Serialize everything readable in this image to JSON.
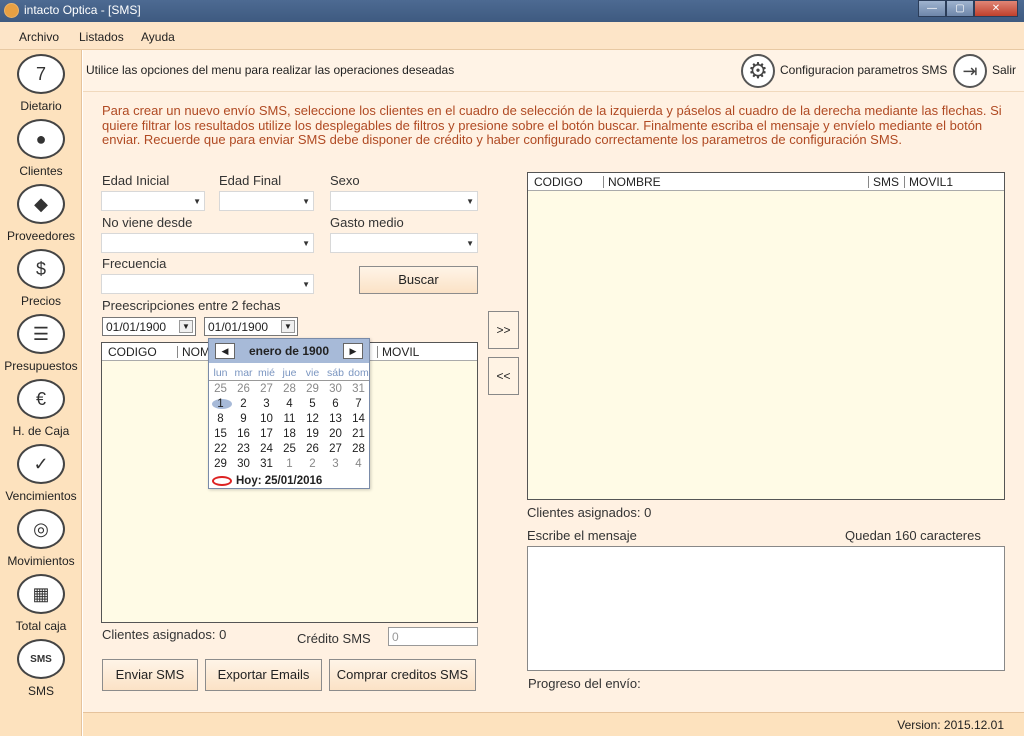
{
  "window": {
    "title": "intacto Optica - [SMS]"
  },
  "menu": [
    "Archivo",
    "Listados",
    "Ayuda"
  ],
  "sidebar": [
    {
      "label": "Dietario",
      "icon": "calendar-icon"
    },
    {
      "label": "Clientes",
      "icon": "user-icon"
    },
    {
      "label": "Proveedores",
      "icon": "supplier-icon"
    },
    {
      "label": "Precios",
      "icon": "price-tag-icon"
    },
    {
      "label": "Presupuestos",
      "icon": "budget-icon"
    },
    {
      "label": "H. de Caja",
      "icon": "cash-sheet-icon"
    },
    {
      "label": "Vencimientos",
      "icon": "checklist-icon"
    },
    {
      "label": "Movimientos",
      "icon": "coins-icon"
    },
    {
      "label": "Total caja",
      "icon": "calculator-icon"
    },
    {
      "label": "SMS",
      "icon": "sms-icon"
    }
  ],
  "toolbar": {
    "hint": "Utilice las opciones del menu para realizar las operaciones deseadas",
    "config_label": "Configuracion parametros SMS",
    "exit_label": "Salir"
  },
  "instructions": "Para crear un nuevo envío SMS, seleccione los clientes en el cuadro de selección de la izquierda y páselos al cuadro de la derecha mediante las flechas. Si quiere filtrar los resultados utilize los desplegables de filtros y presione sobre el botón buscar. Finalmente escriba el mensaje y envíelo mediante el botón enviar. Recuerde que para enviar SMS debe disponer de crédito y haber configurado correctamente los parametros de configuración SMS.",
  "filters": {
    "edad_inicial": "Edad Inicial",
    "edad_final": "Edad Final",
    "sexo": "Sexo",
    "no_viene": "No viene desde",
    "gasto": "Gasto medio",
    "frecuencia": "Frecuencia",
    "buscar": "Buscar",
    "prescripciones": "Preescripciones entre 2 fechas",
    "fecha1": "01/01/1900",
    "fecha2": "01/01/1900"
  },
  "left_grid": {
    "col1": "CODIGO",
    "col2": "NOM",
    "col3": "MOVIL"
  },
  "right_grid": {
    "col1": "CODIGO",
    "col2": "NOMBRE",
    "col3": "SMS",
    "col4": "MOVIL1"
  },
  "transfer": {
    "right": ">>",
    "left": "<<"
  },
  "left_footer": {
    "asignados": "Clientes asignados: 0",
    "credito_label": "Crédito SMS",
    "credito_value": "0"
  },
  "buttons": {
    "enviar": "Enviar SMS",
    "exportar": "Exportar Emails",
    "comprar": "Comprar creditos SMS"
  },
  "right_footer": {
    "asignados": "Clientes asignados: 0",
    "mensaje": "Escribe el mensaje",
    "quedan": "Quedan 160 caracteres",
    "progreso": "Progreso del envío:"
  },
  "calendar": {
    "title": "enero de 1900",
    "prev": "◀",
    "next": "▶",
    "dow": [
      "lun",
      "mar",
      "mié",
      "jue",
      "vie",
      "sáb",
      "dom"
    ],
    "weeks": [
      [
        "25",
        "26",
        "27",
        "28",
        "29",
        "30",
        "31"
      ],
      [
        "1",
        "2",
        "3",
        "4",
        "5",
        "6",
        "7"
      ],
      [
        "8",
        "9",
        "10",
        "11",
        "12",
        "13",
        "14"
      ],
      [
        "15",
        "16",
        "17",
        "18",
        "19",
        "20",
        "21"
      ],
      [
        "22",
        "23",
        "24",
        "25",
        "26",
        "27",
        "28"
      ],
      [
        "29",
        "30",
        "31",
        "1",
        "2",
        "3",
        "4"
      ]
    ],
    "today": "Hoy: 25/01/2016"
  },
  "status": {
    "version": "Version: 2015.12.01"
  }
}
